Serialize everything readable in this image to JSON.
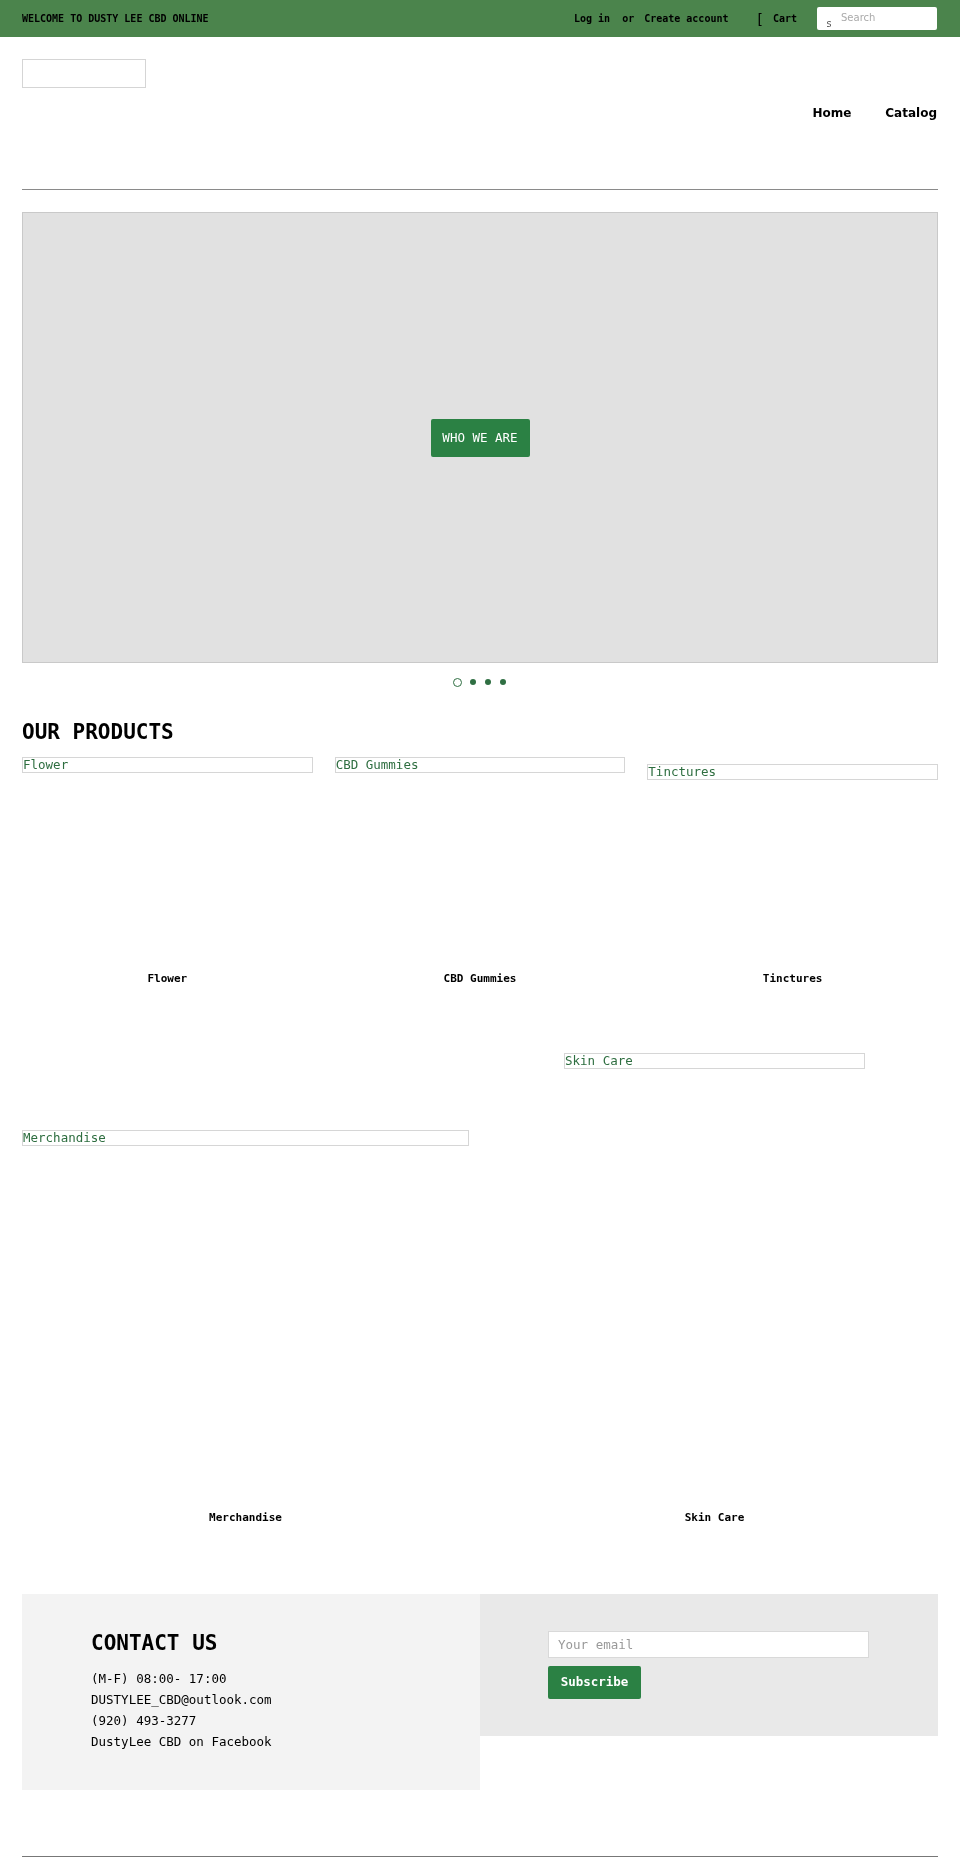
{
  "top_bar": {
    "welcome": "WELCOME TO DUSTY LEE CBD ONLINE",
    "login": "Log in",
    "separator": "or",
    "create_account": "Create account",
    "cart_icon": "[",
    "cart": "Cart",
    "search": {
      "icon": "s",
      "placeholder": "Search"
    }
  },
  "nav": [
    {
      "label": "Home"
    },
    {
      "label": "Catalog"
    }
  ],
  "hero": {
    "button": "WHO WE ARE",
    "dots": [
      {
        "selected": true
      },
      {
        "selected": false
      },
      {
        "selected": false
      },
      {
        "selected": false
      }
    ]
  },
  "products": {
    "title": "OUR PRODUCTS",
    "rows": [
      [
        {
          "image_alt": "Flower",
          "title": "Flower"
        },
        {
          "image_alt": "CBD Gummies",
          "title": "CBD Gummies"
        },
        {
          "image_alt": "Tinctures",
          "title": "Tinctures"
        }
      ],
      [
        {
          "image_alt": "Merchandise",
          "title": "Merchandise"
        },
        {
          "image_alt": "Skin Care",
          "title": "Skin Care"
        }
      ]
    ]
  },
  "footer": {
    "contact": {
      "title": "CONTACT US",
      "lines": [
        "(M-F) 08:00- 17:00",
        "DUSTYLEE_CBD@outlook.com",
        "(920) 493-3277",
        "DustyLee CBD on Facebook"
      ]
    },
    "newsletter": {
      "placeholder": "Your email",
      "button": "Subscribe"
    }
  }
}
